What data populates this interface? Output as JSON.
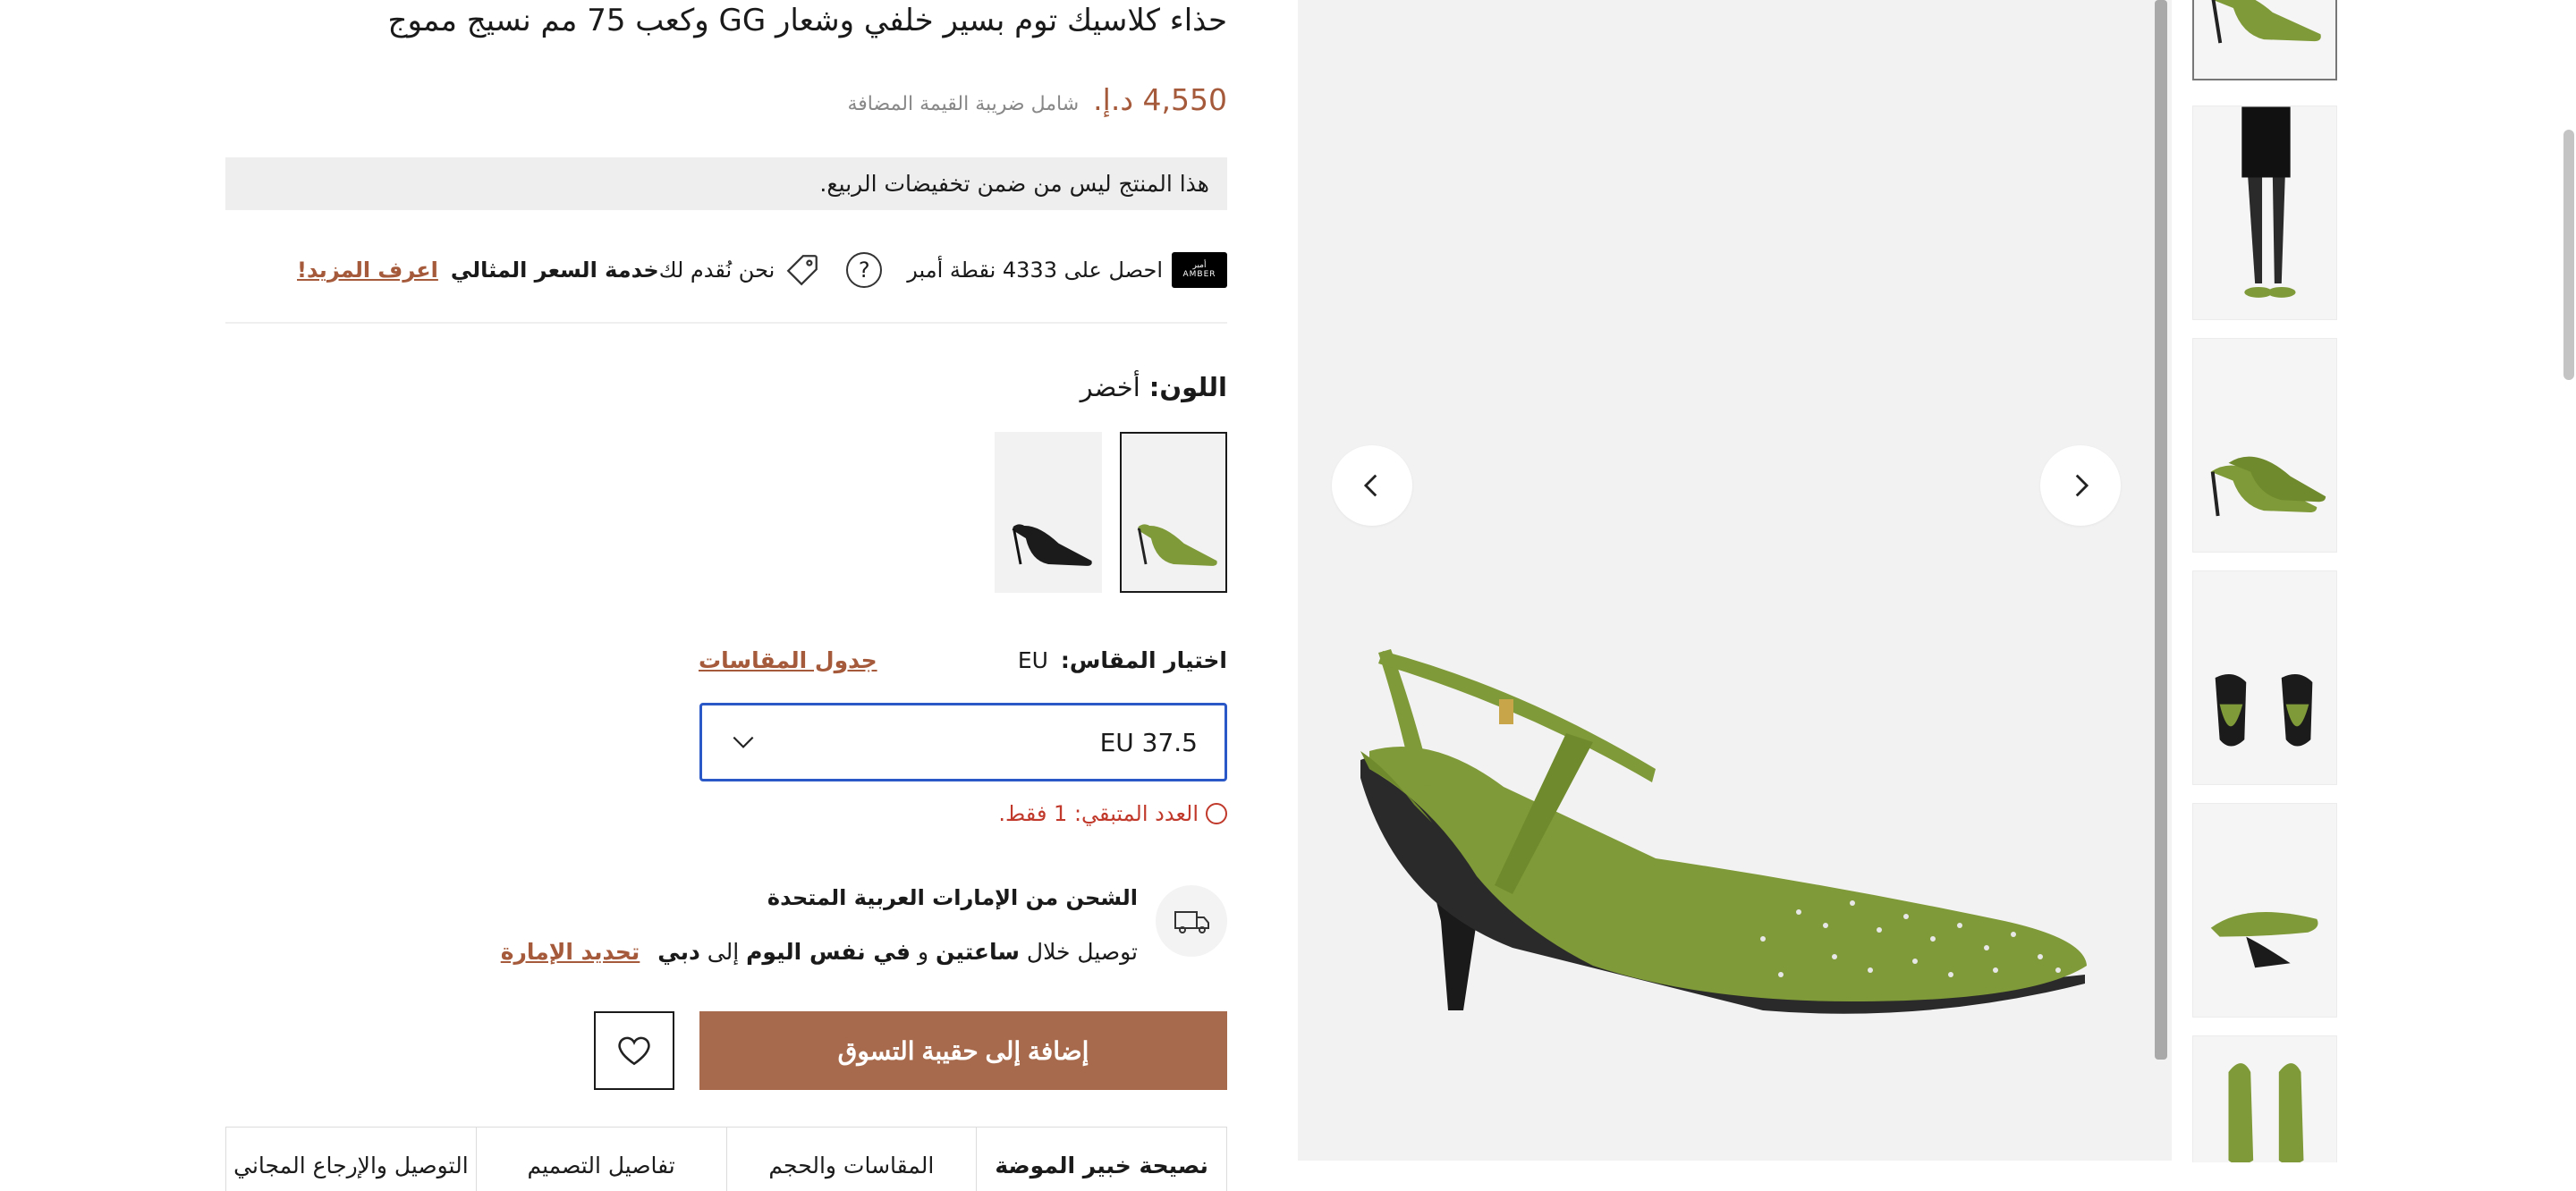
{
  "product": {
    "title": "حذاء كلاسيك توم بسير خلفي وشعار GG وكعب 75 مم نسيج مموج",
    "price": "4,550 د.إ.",
    "vat_note": "شامل ضريبة القيمة المضافة",
    "sale_notice": "هذا المنتج ليس من ضمن تخفيضات الربيع."
  },
  "loyalty": {
    "logo_text": "أمبر",
    "logo_sub": "AMBER",
    "points_text": "احصل على 4333 نقطة أمبر",
    "help_glyph": "?",
    "price_service_prefix": "نحن نُقدم لك ",
    "price_service_bold": "خدمة السعر المثالي",
    "learn_more": "اعرف المزيد!"
  },
  "color": {
    "label": "اللون:",
    "value": "أخضر",
    "swatches": [
      {
        "name": "أخضر",
        "hex": "#7f9a38",
        "selected": true
      },
      {
        "name": "أسود",
        "hex": "#1b1b1b",
        "selected": false
      }
    ]
  },
  "size": {
    "label": "اختيار المقاس:",
    "system": "EU",
    "chart_link": "جدول المقاسات",
    "selected": "EU 37.5"
  },
  "stock": {
    "text": "العدد المتبقي: 1 فقط."
  },
  "shipping": {
    "title": "الشحن من الإمارات العربية المتحدة",
    "p1": "توصيل خلال ",
    "b1": "ساعتين",
    "p2": " و ",
    "b2": "في نفس اليوم",
    "p3": " إلى ",
    "b3": "دبي",
    "change_link": "تحديد الإمارة"
  },
  "actions": {
    "add_to_bag": "إضافة إلى حقيبة التسوق"
  },
  "tabs": [
    {
      "label": "نصيحة خبير الموضة",
      "active": true
    },
    {
      "label": "المقاسات والحجم",
      "active": false
    },
    {
      "label": "تفاصيل التصميم",
      "active": false
    },
    {
      "label": "التوصيل والإرجاع المجاني",
      "active": false
    }
  ],
  "colors": {
    "accent": "#a55a3b",
    "button": "#a86a4c",
    "select_border": "#2a59c7",
    "stock_red": "#c0392b",
    "shoe_green": "#7f9a38"
  }
}
